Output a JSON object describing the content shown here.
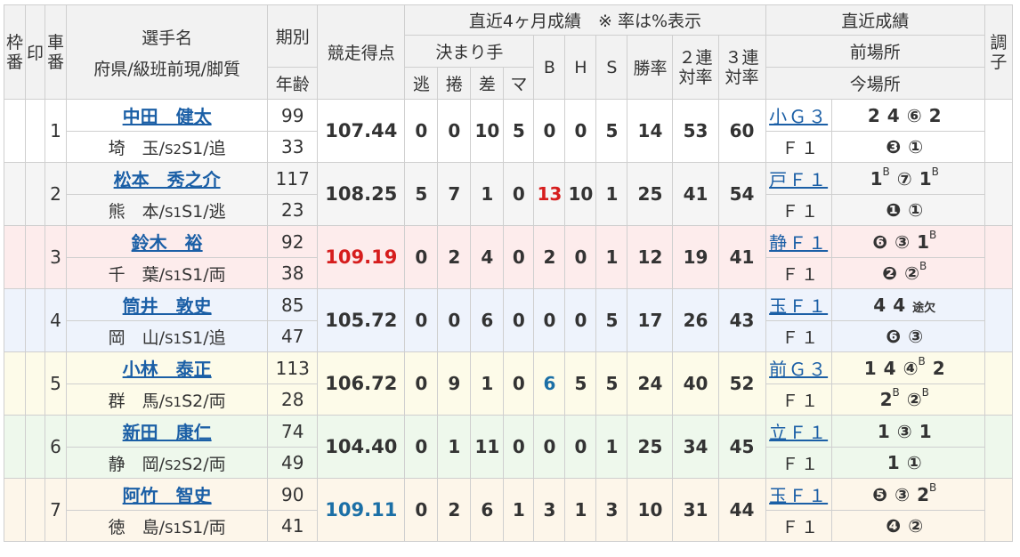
{
  "header": {
    "waku": "枠番",
    "shirushi": "印",
    "shaban": "車番",
    "name_line1": "選手名",
    "name_line2": "府県/級班前現/脚質",
    "kibetsu": "期別",
    "nenrei": "年齢",
    "kyosotokuten": "競走得点",
    "recent4": "直近4ヶ月成績　※ 率は%表示",
    "kimarite": "決まり手",
    "nige": "逃",
    "makuri": "捲",
    "sashi": "差",
    "ma": "マ",
    "b": "B",
    "h": "H",
    "s": "S",
    "shoritsu": "勝率",
    "ren2": "２連対率",
    "ren3": "３連対率",
    "chokkin": "直近成績",
    "zenjo": "前場所",
    "konjo": "今場所",
    "choshi": "調子"
  },
  "riders": [
    {
      "num": "1",
      "name": "中田　健太",
      "pref": "埼　玉/",
      "cls_prev": "S2",
      "cls_now": "S1",
      "style": "/追",
      "ki": "99",
      "age": "33",
      "pts": "107.44",
      "nige": "0",
      "makuri": "0",
      "sashi": "10",
      "ma": "5",
      "b": "0",
      "h": "0",
      "s": "5",
      "win": "14",
      "r2": "53",
      "r3": "60",
      "prev_venue": "小Ｇ３",
      "prev_results": [
        "2",
        "4",
        "⑥",
        "2"
      ],
      "cur_venue": "Ｆ１",
      "cur_results": [
        "❸",
        "①"
      ]
    },
    {
      "num": "2",
      "name": "松本　秀之介",
      "pref": "熊　本/",
      "cls_prev": "S1",
      "cls_now": "S1",
      "style": "/逃",
      "ki": "117",
      "age": "23",
      "pts": "108.25",
      "nige": "5",
      "makuri": "7",
      "sashi": "1",
      "ma": "0",
      "b": "13",
      "h": "10",
      "s": "1",
      "win": "25",
      "r2": "41",
      "r3": "54",
      "prev_venue": "戸Ｆ１",
      "prev_results": [
        "1",
        "⑦",
        "1"
      ],
      "cur_venue": "Ｆ１",
      "cur_results": [
        "❶",
        "①"
      ]
    },
    {
      "num": "3",
      "name": "鈴木　裕",
      "pref": "千　葉/",
      "cls_prev": "S1",
      "cls_now": "S1",
      "style": "/両",
      "ki": "92",
      "age": "38",
      "pts": "109.19",
      "nige": "0",
      "makuri": "2",
      "sashi": "4",
      "ma": "0",
      "b": "2",
      "h": "0",
      "s": "1",
      "win": "12",
      "r2": "19",
      "r3": "41",
      "prev_venue": "静Ｆ１",
      "prev_results": [
        "❻",
        "③",
        "1"
      ],
      "cur_venue": "Ｆ１",
      "cur_results": [
        "❷",
        "②"
      ]
    },
    {
      "num": "4",
      "name": "筒井　敦史",
      "pref": "岡　山/",
      "cls_prev": "S1",
      "cls_now": "S1",
      "style": "/追",
      "ki": "85",
      "age": "47",
      "pts": "105.72",
      "nige": "0",
      "makuri": "0",
      "sashi": "6",
      "ma": "0",
      "b": "0",
      "h": "0",
      "s": "5",
      "win": "17",
      "r2": "26",
      "r3": "43",
      "prev_venue": "玉Ｆ１",
      "prev_results": [
        "4",
        "4",
        "途欠"
      ],
      "cur_venue": "Ｆ１",
      "cur_results": [
        "❻",
        "③"
      ]
    },
    {
      "num": "5",
      "name": "小林　泰正",
      "pref": "群　馬/",
      "cls_prev": "S1",
      "cls_now": "S2",
      "style": "/両",
      "ki": "113",
      "age": "28",
      "pts": "106.72",
      "nige": "0",
      "makuri": "9",
      "sashi": "1",
      "ma": "0",
      "b": "6",
      "h": "5",
      "s": "5",
      "win": "24",
      "r2": "40",
      "r3": "52",
      "prev_venue": "前Ｇ３",
      "prev_results": [
        "1",
        "4",
        "④",
        "2"
      ],
      "cur_venue": "Ｆ１",
      "cur_results": [
        "2",
        "②"
      ]
    },
    {
      "num": "6",
      "name": "新田　康仁",
      "pref": "静　岡/",
      "cls_prev": "S2",
      "cls_now": "S2",
      "style": "/両",
      "ki": "74",
      "age": "49",
      "pts": "104.40",
      "nige": "0",
      "makuri": "1",
      "sashi": "11",
      "ma": "0",
      "b": "0",
      "h": "0",
      "s": "1",
      "win": "25",
      "r2": "34",
      "r3": "45",
      "prev_venue": "立Ｆ１",
      "prev_results": [
        "1",
        "③",
        "1"
      ],
      "cur_venue": "Ｆ１",
      "cur_results": [
        "1",
        "①"
      ]
    },
    {
      "num": "7",
      "name": "阿竹　智史",
      "pref": "徳　島/",
      "cls_prev": "S1",
      "cls_now": "S1",
      "style": "/両",
      "ki": "90",
      "age": "41",
      "pts": "109.11",
      "nige": "0",
      "makuri": "2",
      "sashi": "6",
      "ma": "1",
      "b": "3",
      "h": "1",
      "s": "3",
      "win": "10",
      "r2": "31",
      "r3": "44",
      "prev_venue": "玉Ｆ１",
      "prev_results": [
        "❺",
        "③",
        "2"
      ],
      "cur_venue": "Ｆ１",
      "cur_results": [
        "❹",
        "②"
      ]
    }
  ],
  "sup_mark": "B",
  "colors": {
    "link": "#1b5fa6",
    "highlight_red": "#d61d1d",
    "highlight_blue": "#1b6fa6"
  }
}
